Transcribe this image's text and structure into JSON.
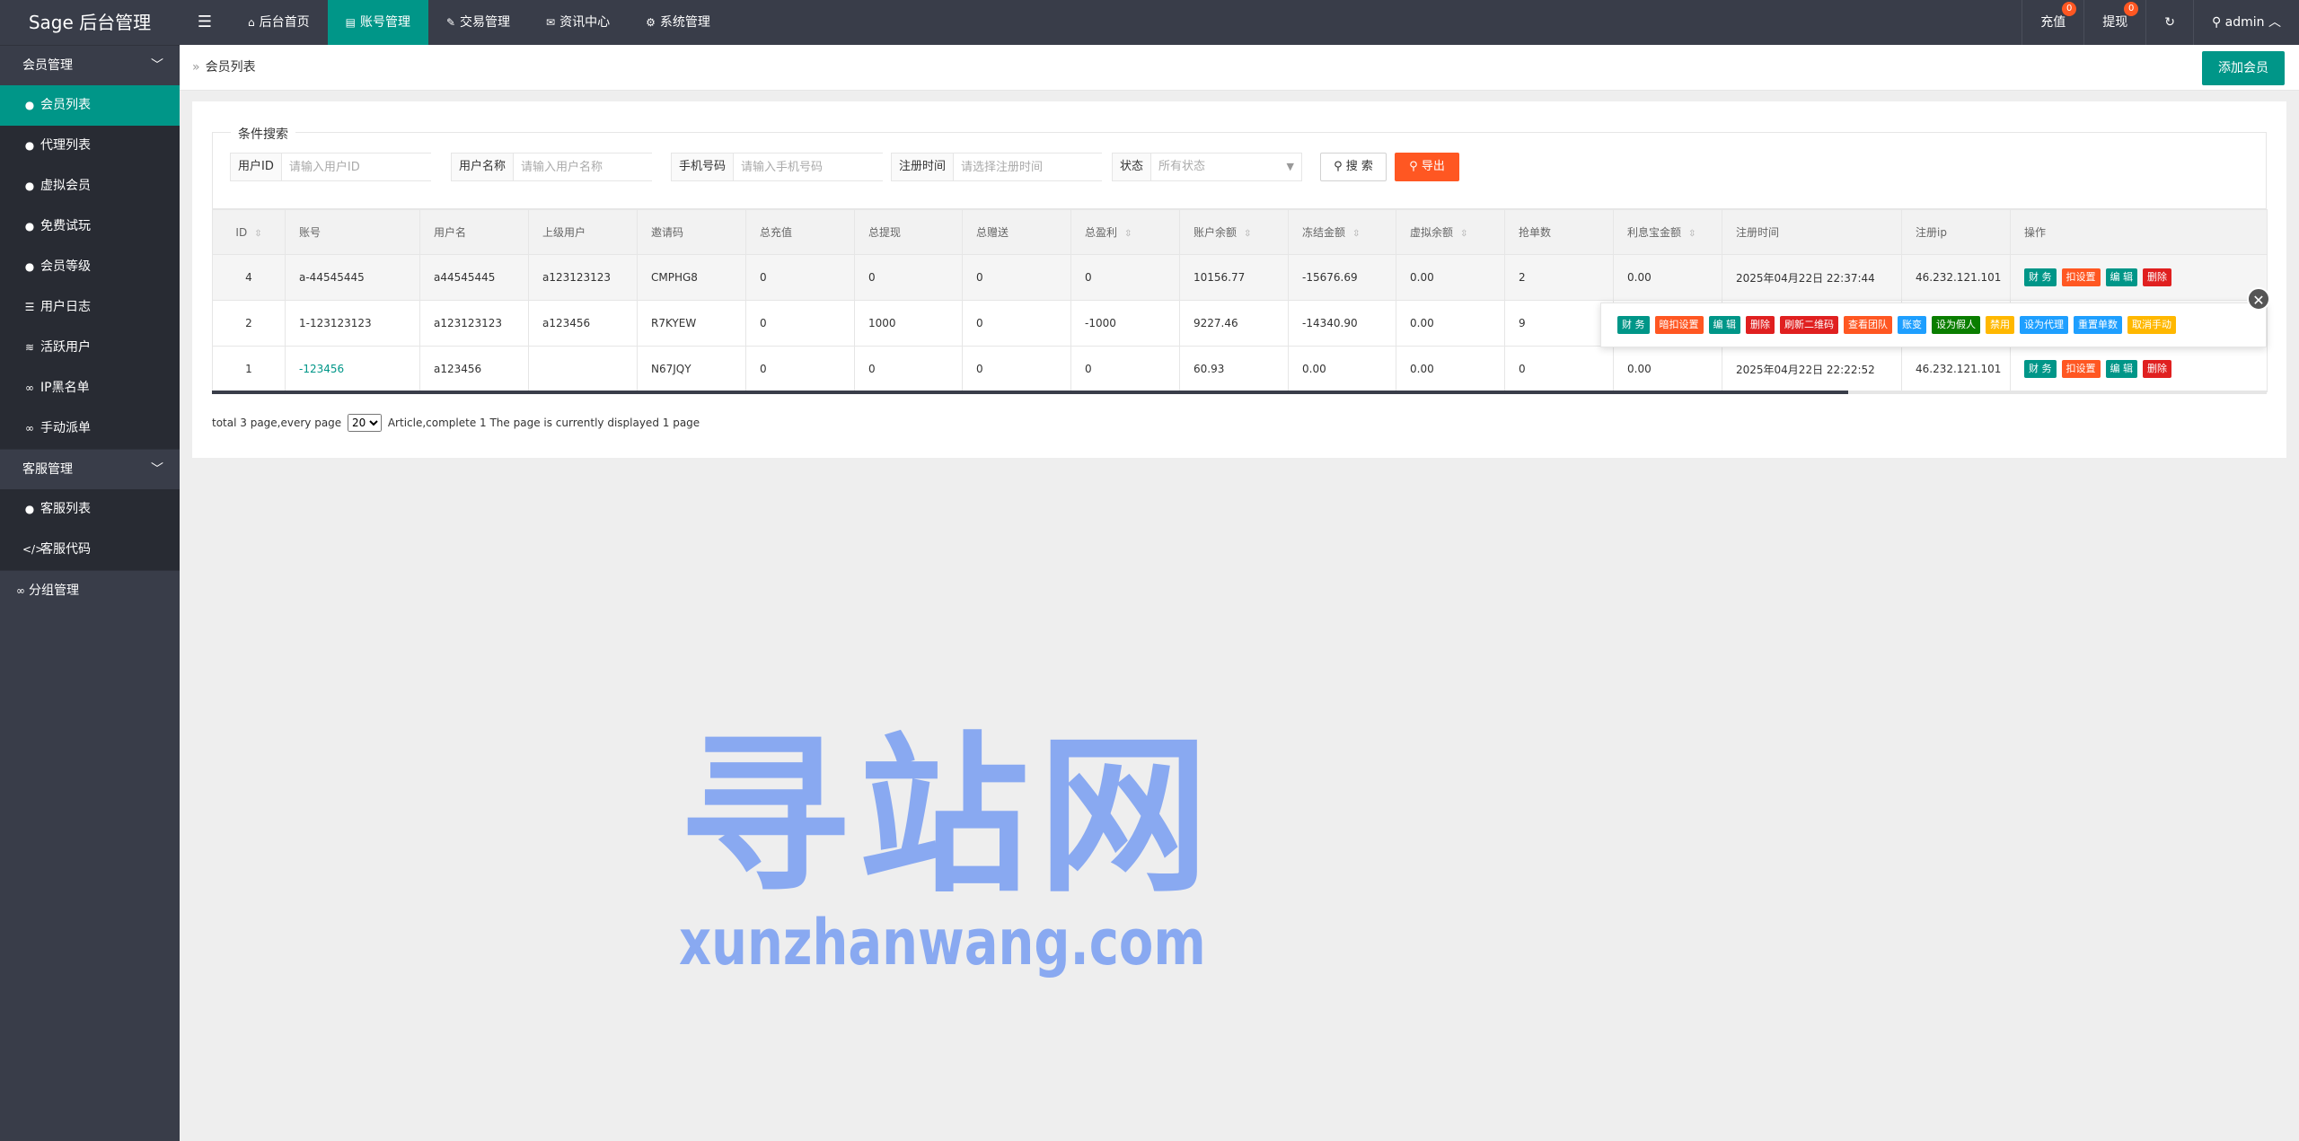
{
  "topbar": {
    "logo": "Sage 后台管理",
    "toggle_icon": "☰",
    "nav": [
      {
        "label": "后台首页",
        "icon": "home-icon",
        "glyph": "⌂"
      },
      {
        "label": "账号管理",
        "icon": "id-card-icon",
        "glyph": "▤"
      },
      {
        "label": "交易管理",
        "icon": "gavel-icon",
        "glyph": "✎"
      },
      {
        "label": "资讯中心",
        "icon": "bullhorn-icon",
        "glyph": "✉"
      },
      {
        "label": "系统管理",
        "icon": "gears-icon",
        "glyph": "⚙"
      }
    ],
    "recharge": {
      "label": "充值",
      "count": "0"
    },
    "withdraw": {
      "label": "提现",
      "count": "0"
    },
    "refresh_icon": "↻",
    "user": "admin"
  },
  "sidebar": {
    "group1": "会员管理",
    "items1": [
      {
        "label": "会员列表",
        "glyph": "●"
      },
      {
        "label": "代理列表",
        "glyph": "●"
      },
      {
        "label": "虚拟会员",
        "glyph": "●"
      },
      {
        "label": "免费试玩",
        "glyph": "●"
      },
      {
        "label": "会员等级",
        "glyph": "●"
      },
      {
        "label": "用户日志",
        "glyph": "☰"
      },
      {
        "label": "活跃用户",
        "glyph": "≋"
      },
      {
        "label": "IP黑名单",
        "glyph": "∞"
      },
      {
        "label": "手动派单",
        "glyph": "∞"
      }
    ],
    "group2": "客服管理",
    "items2": [
      {
        "label": "客服列表",
        "glyph": "●"
      },
      {
        "label": "客服代码",
        "glyph": "</>"
      }
    ],
    "group3": {
      "label": "分组管理",
      "glyph": "∞"
    }
  },
  "breadcrumb": {
    "sep": "»",
    "label": "会员列表"
  },
  "add_button": "添加会员",
  "search": {
    "legend": "条件搜索",
    "fields": [
      {
        "label": "用户ID",
        "placeholder": "请输入用户ID"
      },
      {
        "label": "用户名称",
        "placeholder": "请输入用户名称"
      },
      {
        "label": "手机号码",
        "placeholder": "请输入手机号码"
      },
      {
        "label": "注册时间",
        "placeholder": "请选择注册时间"
      }
    ],
    "status": {
      "label": "状态",
      "value": "所有状态"
    },
    "search_button": "搜 索",
    "export_button": "导出"
  },
  "table": {
    "columns": [
      "ID",
      "账号",
      "用户名",
      "上级用户",
      "邀请码",
      "总充值",
      "总提现",
      "总赠送",
      "总盈利",
      "账户余额",
      "冻结金额",
      "虚拟余额",
      "抢单数",
      "利息宝金额",
      "注册时间",
      "注册ip",
      "操作"
    ],
    "rows": [
      [
        "4",
        "a-44545445",
        "a44545445",
        "a123123123",
        "CMPHG8",
        "0",
        "0",
        "0",
        "0",
        "10156.77",
        "-15676.69",
        "0.00",
        "2",
        "0.00",
        "2025年04月22日 22:37:44",
        "46.232.121.101"
      ],
      [
        "2",
        "1-123123123",
        "a123123123",
        "a123456",
        "R7KYEW",
        "0",
        "1000",
        "0",
        "-1000",
        "9227.46",
        "-14340.90",
        "0.00",
        "9",
        "",
        "",
        ""
      ],
      [
        "1",
        "-123456",
        "a123456",
        "",
        "N67JQY",
        "0",
        "0",
        "0",
        "0",
        "60.93",
        "0.00",
        "0.00",
        "0",
        "0.00",
        "2025年04月22日 22:22:52",
        "46.232.121.101"
      ]
    ],
    "ops": {
      "finance": "财 务",
      "deduct": "扣设置",
      "edit": "编 辑",
      "delete": "删除"
    }
  },
  "popup": {
    "buttons": [
      "财 务",
      "暗扣设置",
      "编 辑",
      "删除",
      "刷新二维码",
      "查看团队",
      "账变",
      "设为假人",
      "禁用",
      "设为代理",
      "重置单数",
      "取消手动"
    ],
    "close": "✕"
  },
  "pager": {
    "prefix": "total 3 page,every page",
    "size": "20",
    "suffix": "Article,complete 1 The page is currently displayed 1 page"
  },
  "watermark": {
    "cn": "寻站网",
    "en": "xunzhanwang.com"
  },
  "colors": {
    "brand": "#009688",
    "dark": "#393d49",
    "danger": "#ff5722"
  }
}
